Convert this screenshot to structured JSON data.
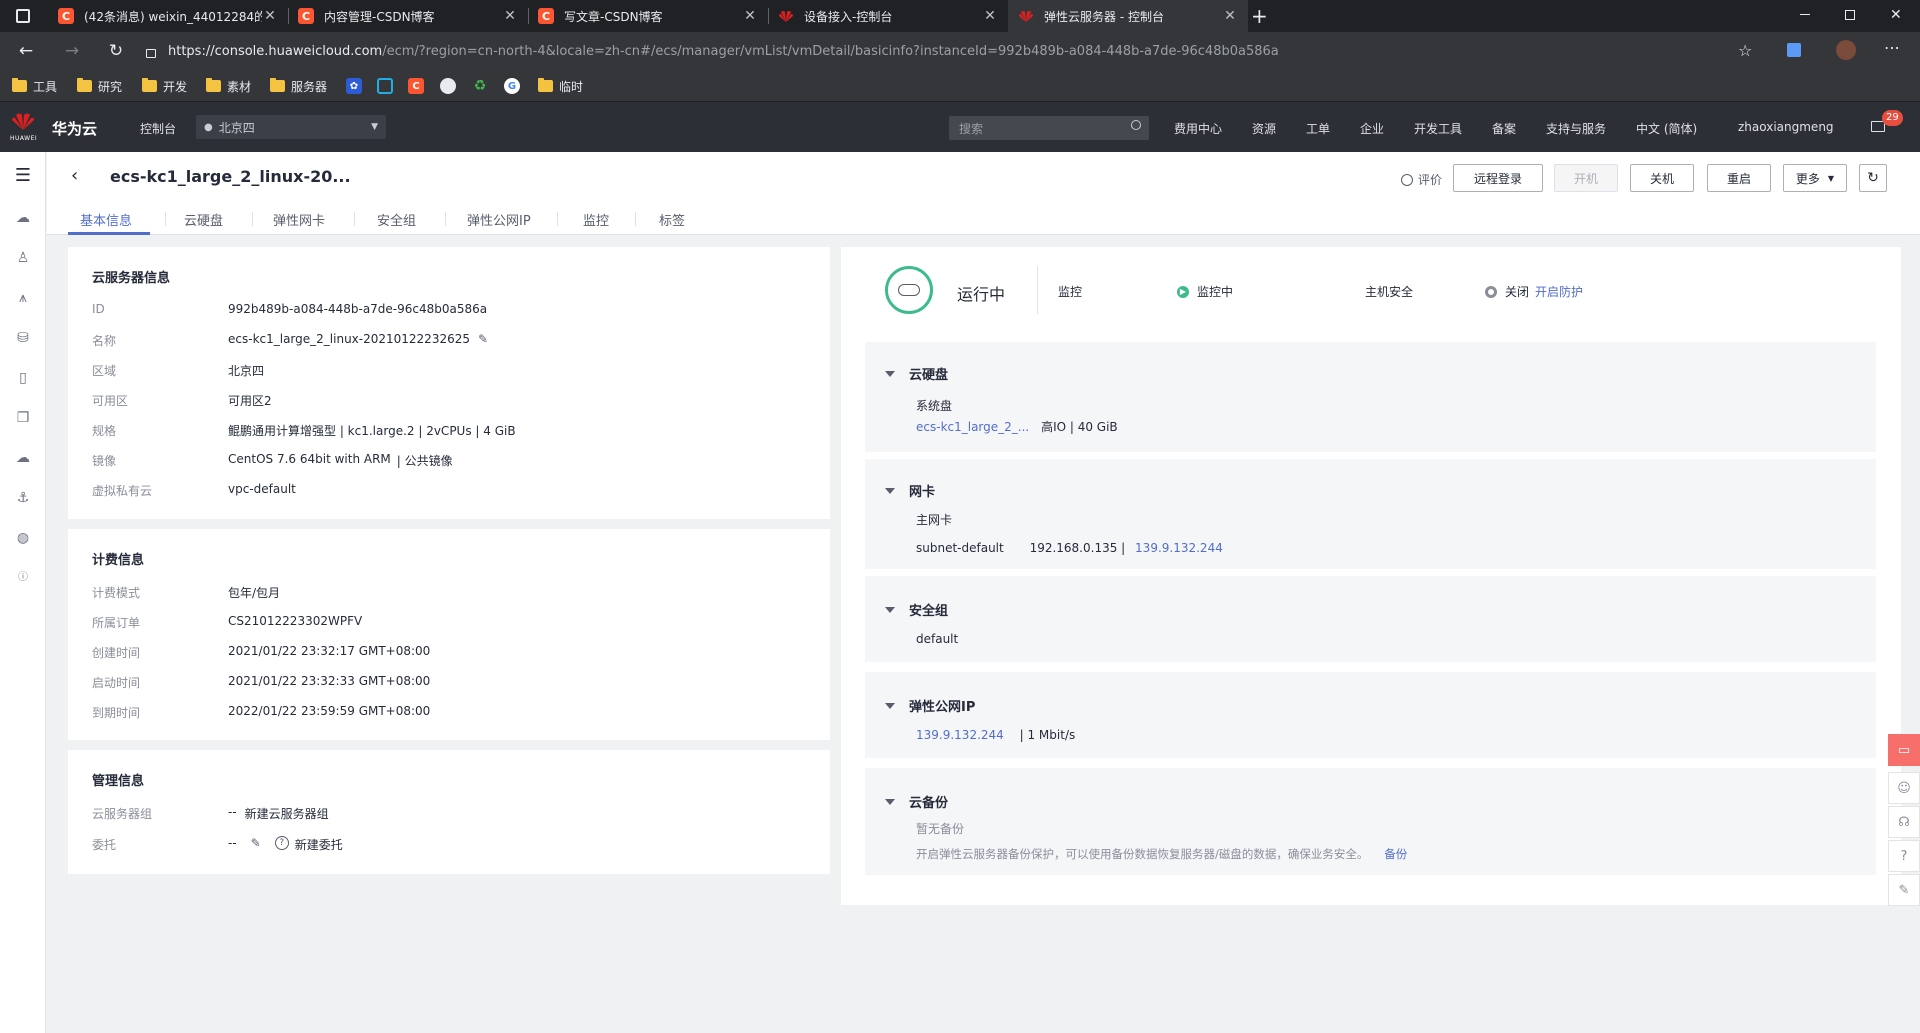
{
  "browser": {
    "tabs": [
      {
        "title": "(42条消息) weixin_44012284的博",
        "icon": "csdn"
      },
      {
        "title": "内容管理-CSDN博客",
        "icon": "csdn"
      },
      {
        "title": "写文章-CSDN博客",
        "icon": "csdn"
      },
      {
        "title": "设备接入-控制台",
        "icon": "huawei"
      },
      {
        "title": "弹性云服务器 - 控制台",
        "icon": "huawei"
      }
    ],
    "url_host": "https://console.huaweicloud.com",
    "url_path": "/ecm/?region=cn-north-4&locale=zh-cn#/ecs/manager/vmList/vmDetail/basicinfo?instanceId=992b489b-a084-448b-a7de-96c48b0a586a",
    "bookmarks": [
      "工具",
      "研究",
      "开发",
      "素材",
      "服务器",
      "临时"
    ]
  },
  "header": {
    "brand": "华为云",
    "logo_text": "HUAWEI",
    "console": "控制台",
    "region": "北京四",
    "search_placeholder": "搜索",
    "nav": [
      "费用中心",
      "资源",
      "工单",
      "企业",
      "开发工具",
      "备案",
      "支持与服务",
      "中文 (简体)",
      "zhaoxiangmeng"
    ],
    "msg_count": "29"
  },
  "page": {
    "title": "ecs-kc1_large_2_linux-20...",
    "tabs": [
      "基本信息",
      "云硬盘",
      "弹性网卡",
      "安全组",
      "弹性公网IP",
      "监控",
      "标签"
    ],
    "rate": "评价",
    "buttons": [
      "远程登录",
      "开机",
      "关机",
      "重启",
      "更多"
    ]
  },
  "server_info": {
    "title": "云服务器信息",
    "rows": [
      {
        "k": "ID",
        "v": "992b489b-a084-448b-a7de-96c48b0a586a"
      },
      {
        "k": "名称",
        "v": "ecs-kc1_large_2_linux-20210122232625"
      },
      {
        "k": "区域",
        "v": "北京四"
      },
      {
        "k": "可用区",
        "v": "可用区2"
      },
      {
        "k": "规格",
        "v": "鲲鹏通用计算增强型 | kc1.large.2 | 2vCPUs | 4 GiB"
      },
      {
        "k": "镜像",
        "v": "CentOS 7.6 64bit with ARM",
        "v2": "| 公共镜像"
      },
      {
        "k": "虚拟私有云",
        "v": "vpc-default"
      }
    ]
  },
  "billing": {
    "title": "计费信息",
    "rows": [
      {
        "k": "计费模式",
        "v": "包年/包月"
      },
      {
        "k": "所属订单",
        "v": "CS21012223302WPFV"
      },
      {
        "k": "创建时间",
        "v": "2021/01/22 23:32:17 GMT+08:00"
      },
      {
        "k": "启动时间",
        "v": "2021/01/22 23:32:33 GMT+08:00"
      },
      {
        "k": "到期时间",
        "v": "2022/01/22 23:59:59 GMT+08:00"
      }
    ]
  },
  "mgmt": {
    "title": "管理信息",
    "group_k": "云服务器组",
    "group_dash": "--",
    "group_link": "新建云服务器组",
    "agency_k": "委托",
    "agency_dash": "--",
    "agency_link": "新建委托"
  },
  "status": {
    "state": "运行中",
    "monitor_k": "监控",
    "monitor_v": "监控中",
    "security_k": "主机安全",
    "security_v": "关闭",
    "security_link": "开启防护"
  },
  "disk": {
    "title": "云硬盘",
    "sub": "系统盘",
    "name": "ecs-kc1_large_2_...",
    "info": "高IO  |  40 GiB"
  },
  "nic": {
    "title": "网卡",
    "sub": "主网卡",
    "subnet": "subnet-default",
    "ip": "192.168.0.135  |",
    "eip": "139.9.132.244"
  },
  "secgroup": {
    "title": "安全组",
    "name": "default"
  },
  "eip": {
    "title": "弹性公网IP",
    "ip": "139.9.132.244",
    "bw": "|   1 Mbit/s"
  },
  "backup": {
    "title": "云备份",
    "none": "暂无备份",
    "desc": "开启弹性云服务器备份保护，可以使用备份数据恢复服务器/磁盘的数据，确保业务安全。",
    "link": "备份"
  }
}
